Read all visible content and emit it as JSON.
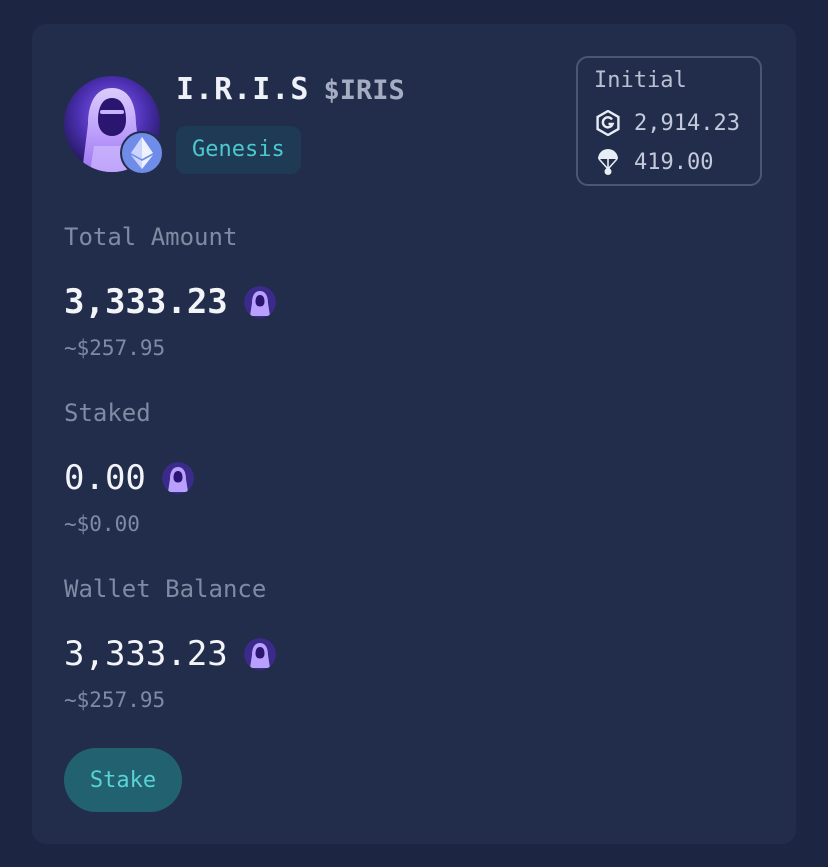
{
  "token": {
    "name": "I.R.I.S",
    "ticker": "$IRIS",
    "badge": "Genesis",
    "avatar_icon": "hooded-figure-avatar-icon",
    "chain_icon": "ethereum-icon"
  },
  "initial": {
    "title": "Initial",
    "rows": [
      {
        "icon": "g-coin-icon",
        "value": "2,914.23"
      },
      {
        "icon": "parachute-airdrop-icon",
        "value": "419.00"
      }
    ]
  },
  "sections": {
    "total": {
      "label": "Total Amount",
      "amount": "3,333.23",
      "usd": "~$257.95"
    },
    "staked": {
      "label": "Staked",
      "amount": "0.00",
      "usd": "~$0.00"
    },
    "wallet": {
      "label": "Wallet Balance",
      "amount": "3,333.23",
      "usd": "~$257.95"
    }
  },
  "actions": {
    "stake_label": "Stake"
  },
  "colors": {
    "background": "#1c2643",
    "card": "#222d4c",
    "accent_teal": "#4cc8cf",
    "stake_button_bg": "#226270",
    "token_purple": "#7b5cf0"
  }
}
